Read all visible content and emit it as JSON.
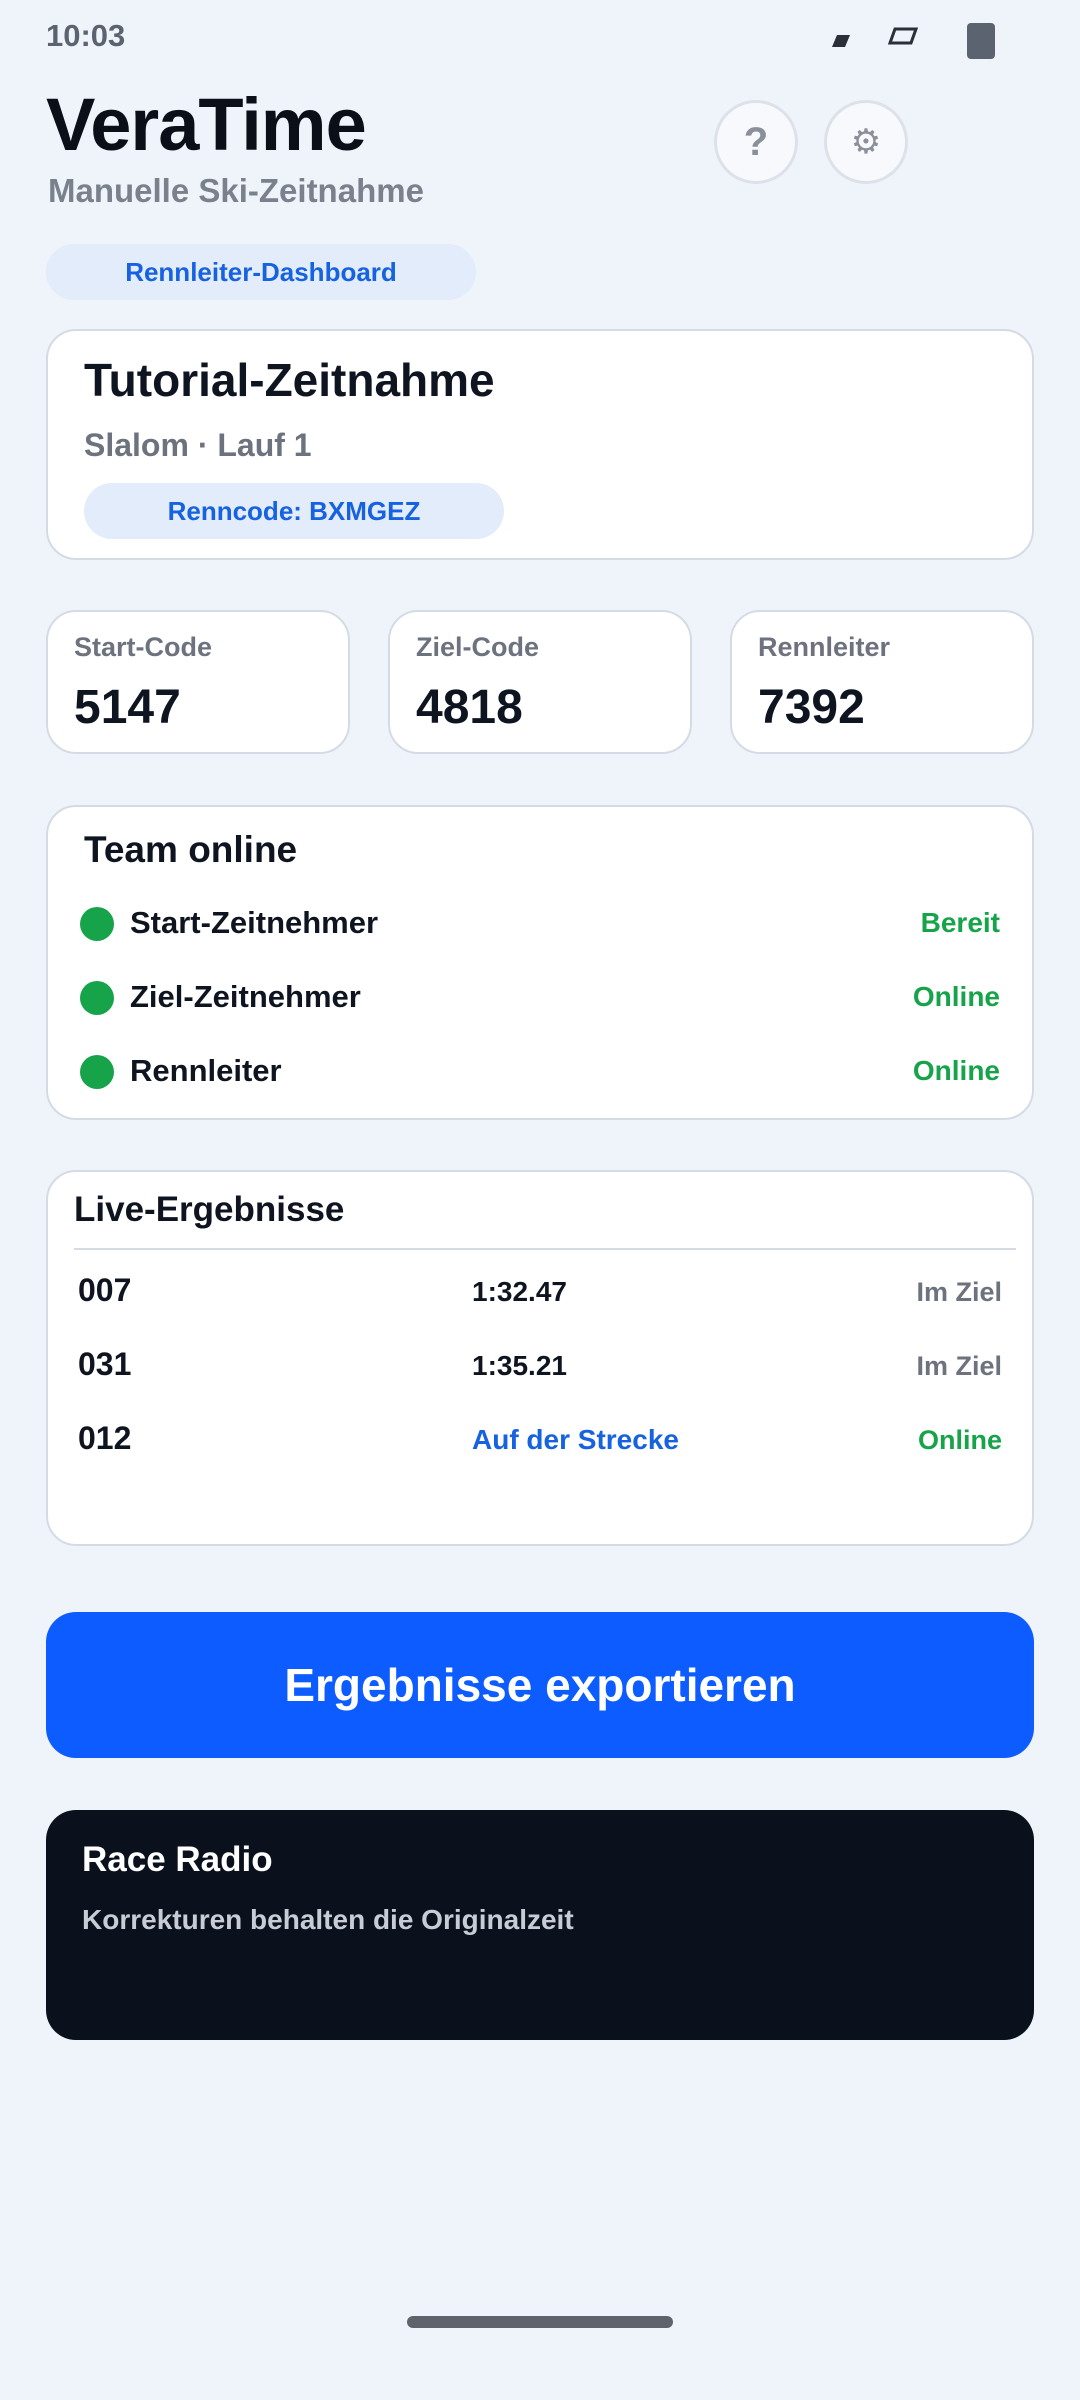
{
  "status_bar": {
    "time": "10:03"
  },
  "header": {
    "title": "VeraTime",
    "subtitle": "Manuelle Ski-Zeitnahme",
    "help_symbol": "?",
    "settings_symbol": "⚙",
    "dashboard_pill": "Rennleiter-Dashboard"
  },
  "race": {
    "title": "Tutorial-Zeitnahme",
    "subtitle": "Slalom · Lauf 1",
    "code": "Renncode: BXMGEZ"
  },
  "codes": [
    {
      "label": "Start-Code",
      "value": "5147"
    },
    {
      "label": "Ziel-Code",
      "value": "4818"
    },
    {
      "label": "Rennleiter",
      "value": "7392"
    }
  ],
  "team": {
    "title": "Team online",
    "members": [
      {
        "name": "Start-Zeitnehmer",
        "status": "Bereit"
      },
      {
        "name": "Ziel-Zeitnehmer",
        "status": "Online"
      },
      {
        "name": "Rennleiter",
        "status": "Online"
      }
    ]
  },
  "live": {
    "title": "Live-Ergebnisse",
    "rows": [
      {
        "bib": "007",
        "time": "1:32.47",
        "state": "Im Ziel"
      },
      {
        "bib": "031",
        "time": "1:35.21",
        "state": "Im Ziel"
      },
      {
        "bib": "012",
        "time": "Auf der Strecke",
        "state": "Online"
      }
    ]
  },
  "actions": {
    "export_label": "Ergebnisse exportieren"
  },
  "radio": {
    "title": "Race Radio",
    "message": "Korrekturen behalten die Originalzeit"
  },
  "colors": {
    "accent": "#0d5cff",
    "online": "#16a34a",
    "background": "#eff3fa",
    "radio_bg": "#0a111c"
  }
}
